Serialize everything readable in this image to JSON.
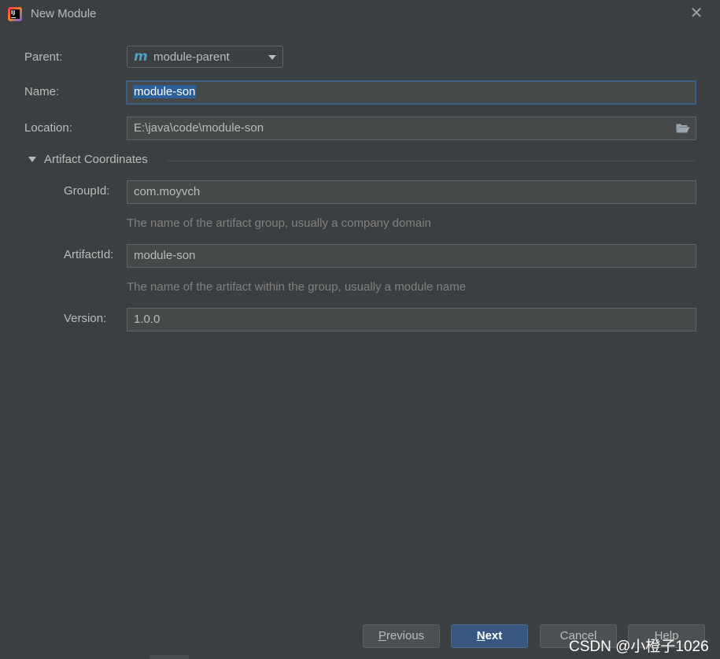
{
  "window": {
    "title": "New Module"
  },
  "form": {
    "parent": {
      "label": "Parent:",
      "value": "module-parent",
      "icon": "maven-icon"
    },
    "name": {
      "label": "Name:",
      "value": "module-son"
    },
    "location": {
      "label": "Location:",
      "value": "E:\\java\\code\\module-son"
    }
  },
  "artifact": {
    "section_title": "Artifact Coordinates",
    "group_id": {
      "label": "GroupId:",
      "value": "com.moyvch",
      "hint": "The name of the artifact group, usually a company domain"
    },
    "artifact_id": {
      "label": "ArtifactId:",
      "value": "module-son",
      "hint": "The name of the artifact within the group, usually a module name"
    },
    "version": {
      "label": "Version:",
      "value": "1.0.0"
    }
  },
  "buttons": {
    "previous": {
      "mnemonic": "P",
      "rest": "revious"
    },
    "next": {
      "mnemonic": "N",
      "rest": "ext"
    },
    "cancel": "Cancel",
    "help": "Help"
  },
  "watermark": "CSDN @小橙子1026",
  "colors": {
    "background": "#3c3f41",
    "field": "#45494a",
    "focus_border": "#3d6185",
    "primary_button": "#365880",
    "maven_icon": "#4d9ec4"
  }
}
